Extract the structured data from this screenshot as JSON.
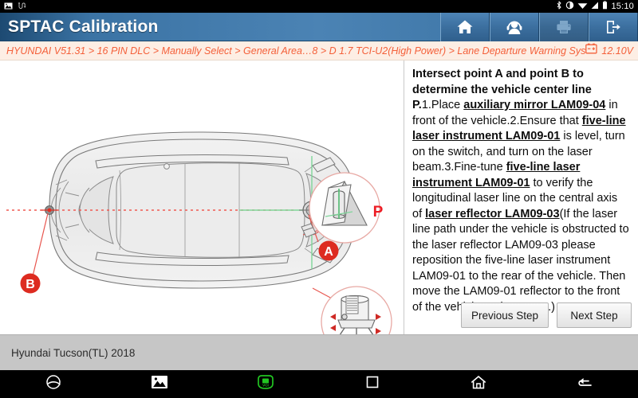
{
  "statusbar": {
    "icons_left": [
      "image-icon",
      "usb-icon"
    ],
    "icons_right": [
      "bluetooth-icon",
      "brightness-icon",
      "wifi-icon",
      "signal-icon",
      "battery-icon"
    ],
    "time": "15:10"
  },
  "titlebar": {
    "title": "SPTAC Calibration",
    "buttons": [
      {
        "name": "home-button",
        "icon": "home-icon",
        "enabled": true
      },
      {
        "name": "support-button",
        "icon": "headset-icon",
        "enabled": true
      },
      {
        "name": "print-button",
        "icon": "printer-icon",
        "enabled": false
      },
      {
        "name": "exit-button",
        "icon": "exit-icon",
        "enabled": true
      }
    ]
  },
  "breadcrumb": {
    "path": "HYUNDAI V51.31 > 16 PIN DLC > Manually Select > General Area…8 > D 1.7 TCI-U2(High Power) > Lane Departure Warning System",
    "battery_icon": "car-battery-icon",
    "voltage": "12.10V"
  },
  "diagram": {
    "name": "vehicle-top-view-calibration-diagram",
    "point_a_label": "A",
    "point_b_label": "B",
    "center_line_label": "P",
    "callout_mirror": "auxiliary-mirror-detail",
    "callout_laser": "laser-instrument-detail",
    "center_line_color": "#e8413c",
    "laser_line_color": "#52c47a",
    "marker_color": "#d8232a"
  },
  "instructions": {
    "heading": "Intersect point A and point B to determine the vehicle center line P.",
    "step1_pre": "1.Place ",
    "step1_em": "auxiliary mirror LAM09-04",
    "step1_post": " in front of the vehicle.",
    "step2_pre": "2.Ensure that ",
    "step2_em": "five-line laser instrument LAM09-01",
    "step2_post": " is level, turn on the switch, and turn on the laser beam.",
    "step3_pre": "3.Fine-tune ",
    "step3_em1": "five-line laser instrument LAM09-01",
    "step3_mid": " to verify the longitudinal laser line on the central axis of ",
    "step3_em2": "laser reflector LAM09-03",
    "step3_post": "(If the laser line path under the vehicle is obstructed to the laser reflector LAM09-03 please reposition the five-line laser instrument LAM09-01 to the rear of the vehicle. Then move the LAM09-01 reflector to the front of the vehicle and recenter.)"
  },
  "buttons": {
    "previous_label": "Previous Step",
    "next_label": "Next Step"
  },
  "footer": {
    "vehicle": "Hyundai Tucson(TL) 2018"
  },
  "navbar": {
    "items": [
      {
        "name": "browser-icon"
      },
      {
        "name": "screenshot-icon"
      },
      {
        "name": "vci-icon"
      },
      {
        "name": "recents-icon"
      },
      {
        "name": "home-nav-icon"
      },
      {
        "name": "back-icon"
      }
    ]
  }
}
